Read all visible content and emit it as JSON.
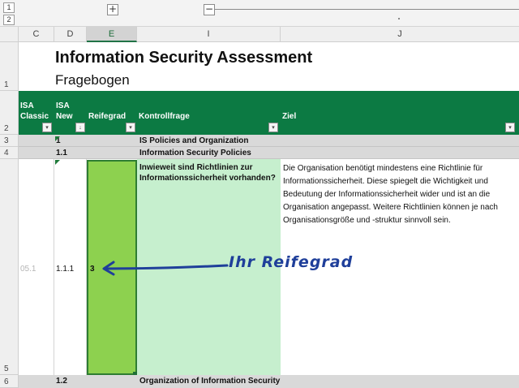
{
  "outline": {
    "levels": [
      "1",
      "2"
    ],
    "expand_symbol": "+",
    "collapse_symbol": "−"
  },
  "columns": [
    {
      "id": "C",
      "label": "C"
    },
    {
      "id": "D",
      "label": "D"
    },
    {
      "id": "E",
      "label": "E"
    },
    {
      "id": "I",
      "label": "I"
    },
    {
      "id": "J",
      "label": "J"
    }
  ],
  "rows": [
    "1",
    "2",
    "3",
    "4",
    "5",
    "6"
  ],
  "sheet": {
    "title": "Information Security Assessment",
    "subtitle": "Fragebogen"
  },
  "header": {
    "isa_classic": "ISA Classic",
    "isa_new": "ISA New",
    "reifegrad": "Reifegrad",
    "kontrollfrage": "Kontrollfrage",
    "ziel": "Ziel",
    "filter_symbol": "▾",
    "sort_symbol": "↓"
  },
  "band_rows": [
    {
      "isa_new": "1",
      "text": "IS Policies and Organization"
    },
    {
      "isa_new": "1.1",
      "text": "Information Security Policies"
    },
    {
      "isa_new": "1.2",
      "text": "Organization of Information Security"
    }
  ],
  "data_row": {
    "isa_classic": "05.1",
    "isa_new": "1.1.1",
    "reifegrad": "3",
    "kontrollfrage": "Inwieweit sind Richtlinien zur Informationssicherheit vorhanden?",
    "ziel": "Die Organisation benötigt mindestens eine Richtlinie für Informationssicherheit. Diese spiegelt die Wichtigkeit und Bedeutung der Informationssicherheit wider und ist an die Organisation angepasst. Weitere Richtlinien können je nach Organisationsgröße und -struktur sinnvoll sein."
  },
  "annotation": {
    "text": "Ihr Reifegrad",
    "color": "#1f3f9a"
  },
  "colors": {
    "header_green": "#0c7a43",
    "maturity_fill": "#8dd14f",
    "question_fill": "#c6efce",
    "band_grey": "#d9d9d9"
  }
}
